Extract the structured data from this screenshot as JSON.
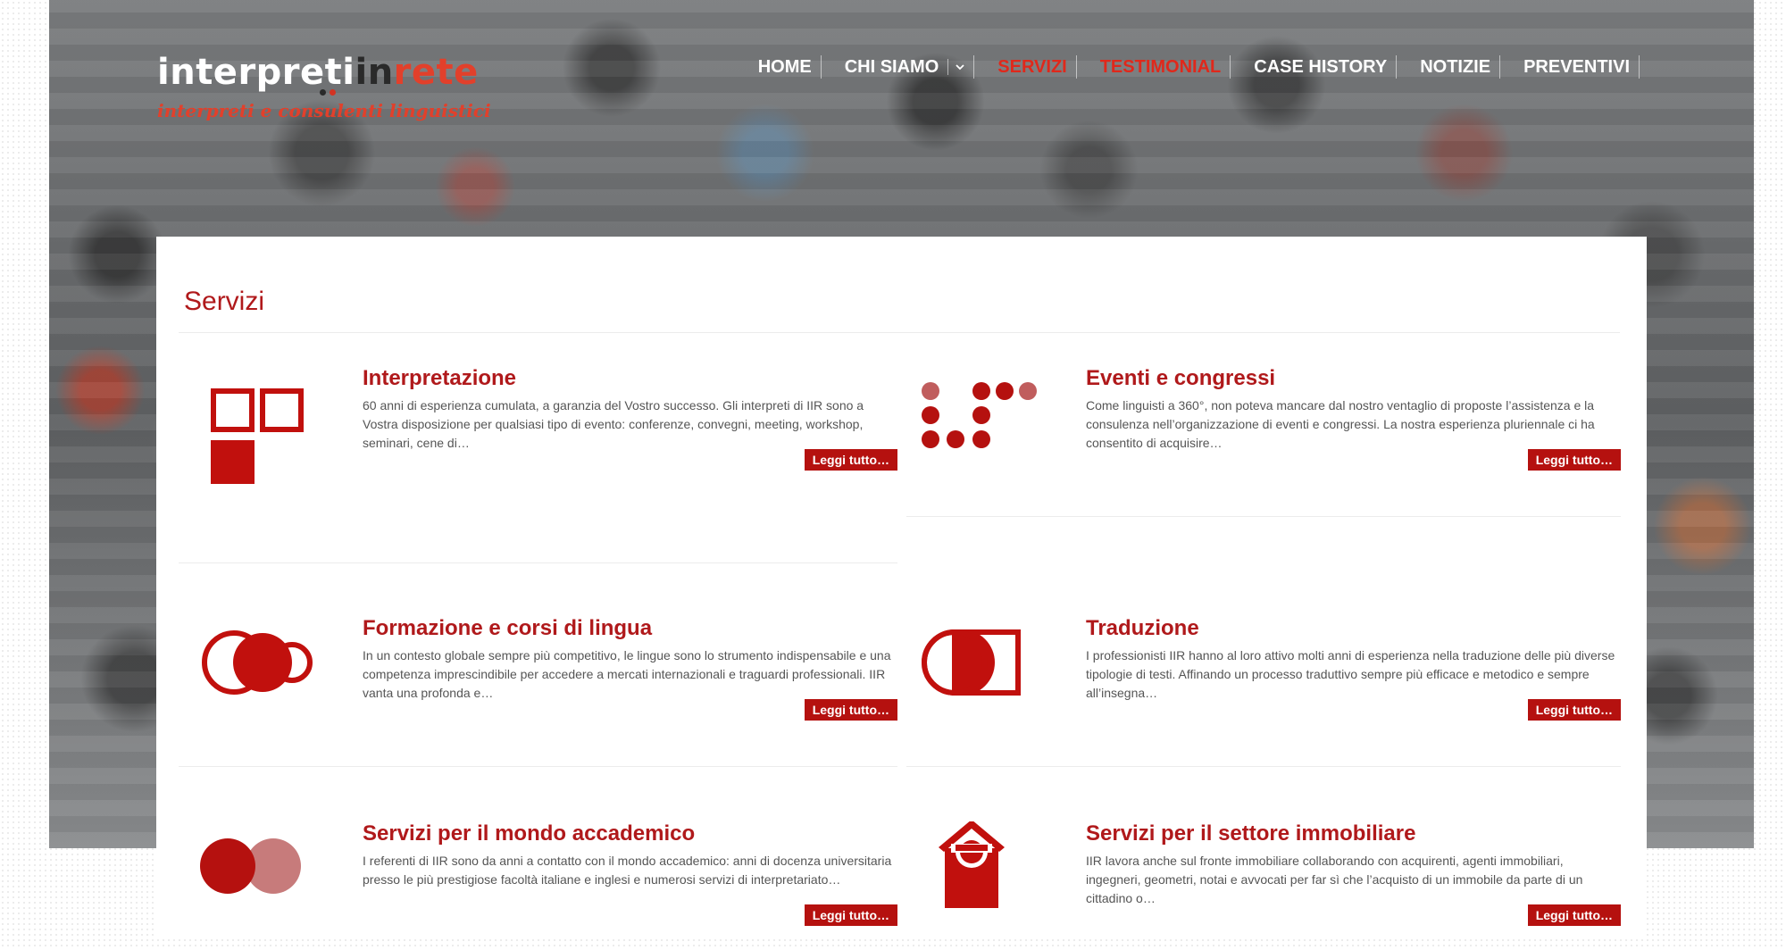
{
  "brand": {
    "logo_word_white": "interpreti",
    "logo_word_dark": "in",
    "logo_word_red": "rete",
    "tagline": "interpreti e consulenti linguistici",
    "accent_color": "#b5110f"
  },
  "nav": {
    "items": [
      {
        "label": "HOME",
        "active": false
      },
      {
        "label": "CHI SIAMO",
        "active": false,
        "dropdown": true
      },
      {
        "label": "SERVIZI",
        "active": true
      },
      {
        "label": "TESTIMONIAL",
        "active": true
      },
      {
        "label": "CASE HISTORY",
        "active": false
      },
      {
        "label": "NOTIZIE",
        "active": false
      },
      {
        "label": "PREVENTIVI",
        "active": false
      }
    ]
  },
  "page": {
    "title": "Servizi"
  },
  "services": [
    {
      "title": "Interpretazione",
      "text": "60 anni di esperienza cumulata, a garanzia del Vostro successo. Gli interpreti di IIR sono a Vostra disposizione per qualsiasi tipo di evento: conferenze, convegni, meeting, workshop, seminari, cene di…",
      "button": "Leggi tutto…",
      "icon": "squares-icon"
    },
    {
      "title": "Eventi e congressi",
      "text": "Come linguisti a 360°, non poteva mancare dal nostro ventaglio di proposte l’assistenza e la consulenza nell’organizzazione di eventi e congressi. La nostra esperienza pluriennale ci ha consentito di acquisire…",
      "button": "Leggi tutto…",
      "icon": "dots-grid-icon"
    },
    {
      "title": "Formazione e corsi di lingua",
      "text": "In un contesto globale sempre più competitivo, le lingue sono lo strumento indispensabile e una competenza imprescindibile per accedere a mercati internazionali e traguardi professionali.  IIR vanta una profonda e…",
      "button": "Leggi tutto…",
      "icon": "linked-circles-icon"
    },
    {
      "title": "Traduzione",
      "text": "I professionisti IIR hanno al loro attivo molti anni di esperienza nella traduzione delle più diverse tipologie di testi. Affinando un processo traduttivo sempre più efficace e metodico e sempre all’insegna…",
      "button": "Leggi tutto…",
      "icon": "half-circle-square-icon"
    },
    {
      "title": "Servizi per il mondo accademico",
      "text": "I referenti di IIR sono da anni a contatto con il mondo accademico: anni di docenza universitaria presso le più prestigiose facoltà italiane e inglesi e numerosi servizi di interpretariato…",
      "button": "Leggi tutto…",
      "icon": "two-circles-icon"
    },
    {
      "title": "Servizi per il settore immobiliare",
      "text": "IIR lavora anche sul fronte immobiliare collaborando con acquirenti, agenti immobiliari, ingegneri, geometri, notai e avvocati per far sì che l’acquisto di un immobile da parte di un cittadino o…",
      "button": "Leggi tutto…",
      "icon": "house-icon"
    }
  ]
}
